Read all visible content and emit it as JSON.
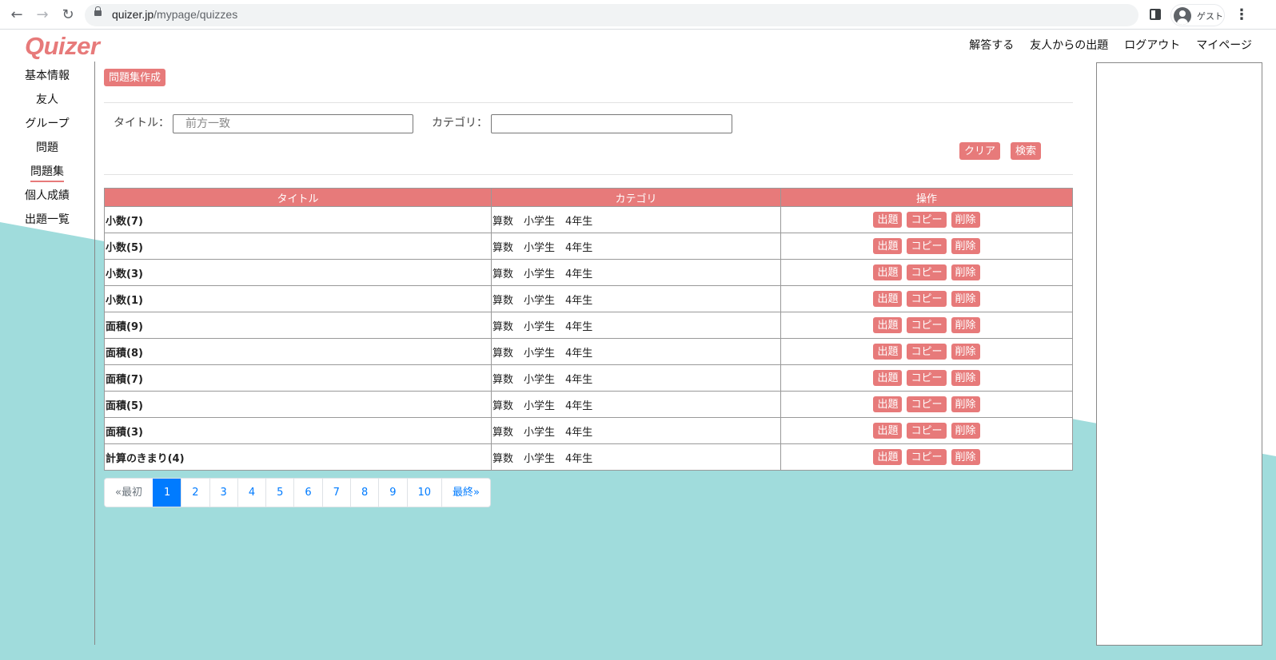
{
  "browser": {
    "url_host": "quizer.jp",
    "url_path": "/mypage/quizzes",
    "profile_label": "ゲスト"
  },
  "colors": {
    "accent": "#e77a7a",
    "teal": "#a0dcdc",
    "page_active": "#007bff"
  },
  "header": {
    "logo": "Quizer",
    "nav": [
      "解答する",
      "友人からの出題",
      "ログアウト",
      "マイページ"
    ]
  },
  "sidebar": {
    "items": [
      "基本情報",
      "友人",
      "グループ",
      "問題",
      "問題集",
      "個人成績",
      "出題一覧"
    ],
    "active": "問題集"
  },
  "toolbar": {
    "create_label": "問題集作成"
  },
  "search": {
    "title_label": "タイトル：",
    "title_placeholder": "前方一致",
    "title_value": "",
    "category_label": "カテゴリ：",
    "category_value": "",
    "clear_label": "クリア",
    "search_label": "検索"
  },
  "table": {
    "headers": [
      "タイトル",
      "カテゴリ",
      "操作"
    ],
    "action_labels": [
      "出題",
      "コピー",
      "削除"
    ],
    "rows": [
      {
        "title": "小数(7)",
        "category": "算数　小学生　4年生"
      },
      {
        "title": "小数(5)",
        "category": "算数　小学生　4年生"
      },
      {
        "title": "小数(3)",
        "category": "算数　小学生　4年生"
      },
      {
        "title": "小数(1)",
        "category": "算数　小学生　4年生"
      },
      {
        "title": "面積(9)",
        "category": "算数　小学生　4年生"
      },
      {
        "title": "面積(8)",
        "category": "算数　小学生　4年生"
      },
      {
        "title": "面積(7)",
        "category": "算数　小学生　4年生"
      },
      {
        "title": "面積(5)",
        "category": "算数　小学生　4年生"
      },
      {
        "title": "面積(3)",
        "category": "算数　小学生　4年生"
      },
      {
        "title": "計算のきまり(4)",
        "category": "算数　小学生　4年生"
      }
    ]
  },
  "pagination": {
    "items": [
      "«最初",
      "1",
      "2",
      "3",
      "4",
      "5",
      "6",
      "7",
      "8",
      "9",
      "10",
      "最終»"
    ],
    "active": "1"
  }
}
